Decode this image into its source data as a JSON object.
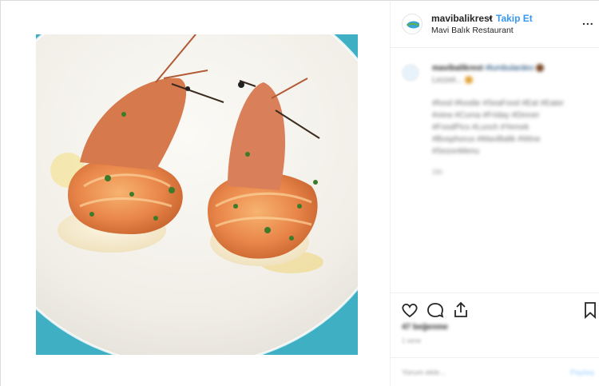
{
  "post": {
    "image_alt_icon": "food-photo",
    "photo_colors": {
      "plate": "#f7f5f0",
      "rim": "#3fb0c4",
      "shrimp": "#e9864a"
    }
  },
  "header": {
    "username": "mavibalikrest",
    "separator": "•",
    "follow_label": "Takip Et",
    "location": "Mavi Balık Restaurant",
    "more_icon": "more-horizontal-icon",
    "more_label": "..."
  },
  "caption": {
    "line1_user": "mavibalikrest",
    "line1_text": "#lumbulardeo",
    "line2_text": "Lezzet...",
    "tags": [
      "#food #foodie #SeaFood #Eat #Eater",
      "#view #Cuma #Friday #Dinner",
      "#FoodPics #Lunch #Yemek",
      "#Bosphorus #MaviBalik #Wine",
      "#SezonMenu"
    ],
    "time": "33h"
  },
  "actions": {
    "like_icon": "heart-icon",
    "comment_icon": "comment-icon",
    "share_icon": "share-icon",
    "save_icon": "bookmark-icon",
    "likes_text": "47 beğenme",
    "ago_text": "1 sene"
  },
  "comment": {
    "placeholder": "Yorum ekle...",
    "submit_label": "Paylaş"
  }
}
